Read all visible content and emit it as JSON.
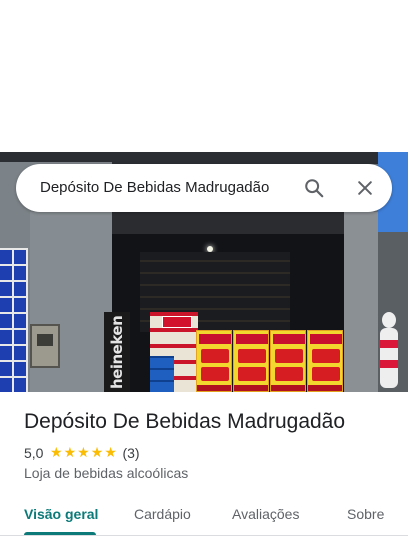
{
  "search": {
    "query": "Depósito De Bebidas Madrugadão",
    "search_icon": "search-icon",
    "close_icon": "close-icon"
  },
  "place": {
    "name": "Depósito De Bebidas Madrugadão",
    "rating": "5,0",
    "rating_value": 5.0,
    "stars_max": 5,
    "review_count": "(3)",
    "category": "Loja de bebidas alcoólicas"
  },
  "photo": {
    "storefront_sign": "heineken"
  },
  "tabs": [
    {
      "label": "Visão geral",
      "active": true
    },
    {
      "label": "Cardápio",
      "active": false
    },
    {
      "label": "Avaliações",
      "active": false
    },
    {
      "label": "Sobre",
      "active": false
    }
  ],
  "colors": {
    "accent": "#0b7a78",
    "star": "#fbbc04",
    "title_text": "#202124",
    "secondary_text": "#5f6368"
  }
}
